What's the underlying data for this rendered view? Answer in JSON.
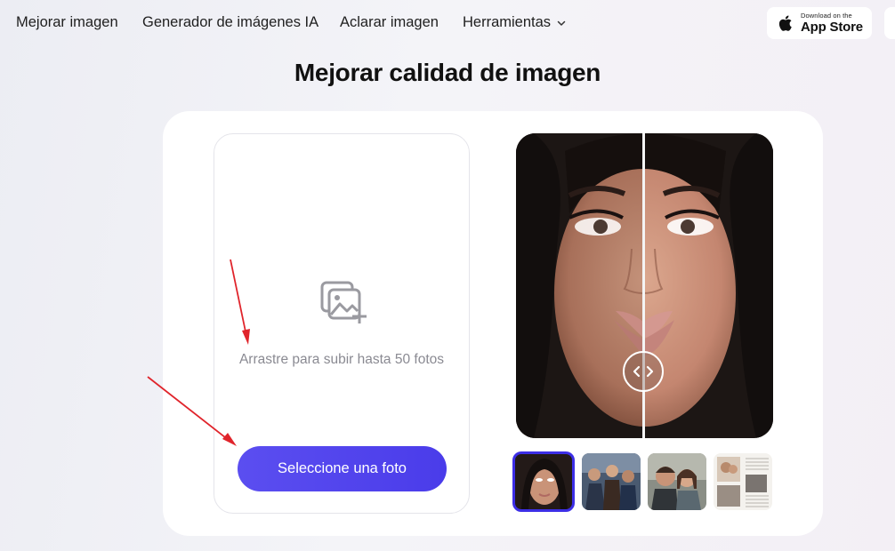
{
  "nav": {
    "items": [
      "Mejorar imagen",
      "Generador de imágenes IA",
      "Aclarar imagen"
    ],
    "tools_label": "Herramientas",
    "app_store": {
      "small": "Download on the",
      "big": "App Store"
    }
  },
  "page": {
    "title": "Mejorar calidad de imagen"
  },
  "upload": {
    "hint": "Arrastre para subir hasta 50 fotos",
    "button_label": "Seleccione una foto"
  },
  "icons": {
    "upload": "image-plus-icon",
    "tools": "chevron-down-icon",
    "apple": "apple-logo-icon",
    "compare": "compare-arrows-icon"
  },
  "colors": {
    "accent": "#4a3cea",
    "annotation_arrow": "#e0242b",
    "hint_text": "#8a8a92"
  },
  "thumbnails": [
    {
      "subject": "woman-portrait",
      "active": true
    },
    {
      "subject": "group-photo",
      "active": false
    },
    {
      "subject": "couple-photo",
      "active": false
    },
    {
      "subject": "old-newspaper-photo",
      "active": false
    }
  ]
}
